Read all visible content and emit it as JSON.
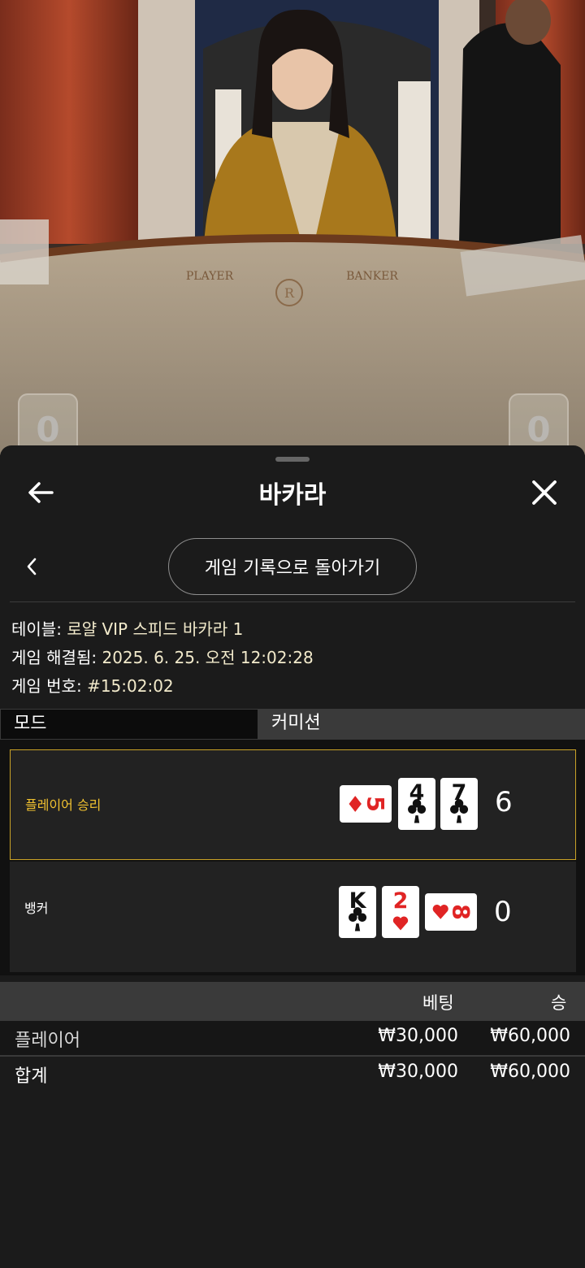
{
  "video": {
    "table_labels": {
      "player": "PLAYER",
      "banker": "BANKER"
    },
    "player_score": "0",
    "banker_score": "0"
  },
  "sheet": {
    "title": "바카라",
    "back_to_history": "게임 기록으로 돌아가기",
    "info": {
      "table_label": "테이블:",
      "table_value": "로얄 VIP 스피드 바카라 1",
      "resolved_label": "게임 해결됨:",
      "resolved_value": "2025. 6. 25. 오전 12:02:28",
      "game_no_label": "게임 번호:",
      "game_no_value": "#15:02:02"
    },
    "tabs": {
      "mode": "모드",
      "commission": "커미션"
    }
  },
  "results": {
    "player": {
      "label": "플레이어 승리",
      "total": "6",
      "cards": [
        {
          "rank": "5",
          "suit": "diamond",
          "color": "#e02424",
          "rotated": true
        },
        {
          "rank": "4",
          "suit": "club",
          "color": "#111111",
          "rotated": false
        },
        {
          "rank": "7",
          "suit": "club",
          "color": "#111111",
          "rotated": false
        }
      ]
    },
    "banker": {
      "label": "뱅커",
      "total": "0",
      "cards": [
        {
          "rank": "K",
          "suit": "club",
          "color": "#111111",
          "rotated": false
        },
        {
          "rank": "2",
          "suit": "heart",
          "color": "#e02424",
          "rotated": false
        },
        {
          "rank": "8",
          "suit": "heart",
          "color": "#e02424",
          "rotated": true
        }
      ]
    }
  },
  "bets": {
    "headers": {
      "bet": "베팅",
      "win": "승"
    },
    "rows": [
      {
        "name": "플레이어",
        "bet": "₩30,000",
        "win": "₩60,000"
      }
    ],
    "total": {
      "name": "합계",
      "bet": "₩30,000",
      "win": "₩60,000"
    }
  },
  "colors": {
    "accent": "#c9a227",
    "winner_text": "#f2c230",
    "red_suit": "#e02424"
  }
}
